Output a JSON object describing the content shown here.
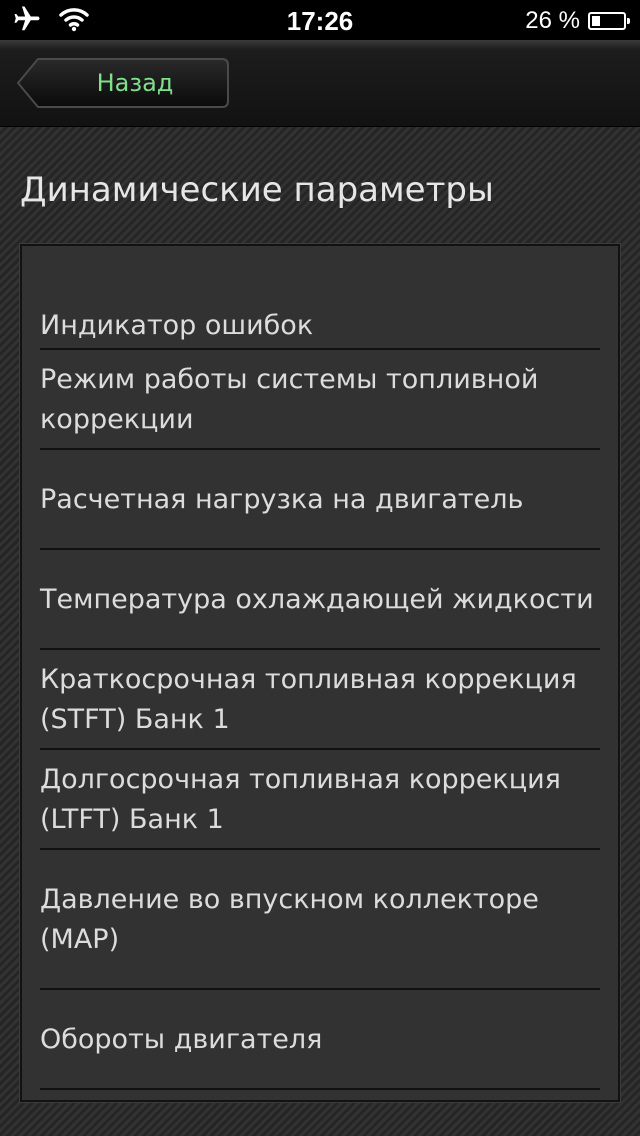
{
  "status_bar": {
    "time": "17:26",
    "battery_percent": "26 %",
    "battery_level": 0.26,
    "icons": [
      "airplane-icon",
      "wifi-icon",
      "battery-icon"
    ]
  },
  "nav": {
    "back_label": "Назад"
  },
  "page": {
    "title": "Динамические параметры"
  },
  "list": {
    "items": [
      {
        "label": "Индикатор ошибок"
      },
      {
        "label": "Режим работы системы топливной коррекции"
      },
      {
        "label": "Расчетная нагрузка на двигатель"
      },
      {
        "label": "Температура охлаждающей жидкости"
      },
      {
        "label": "Краткосрочная топливная коррекция (STFT) Банк 1"
      },
      {
        "label": "Долгосрочная топливная коррекция (LTFT) Банк 1"
      },
      {
        "label": "Давление во впускном коллекторе (MAP)"
      },
      {
        "label": "Обороты двигателя"
      }
    ]
  },
  "colors": {
    "back_label": "#7fe08a",
    "text": "#dcdcdc",
    "panel": "#323232"
  }
}
